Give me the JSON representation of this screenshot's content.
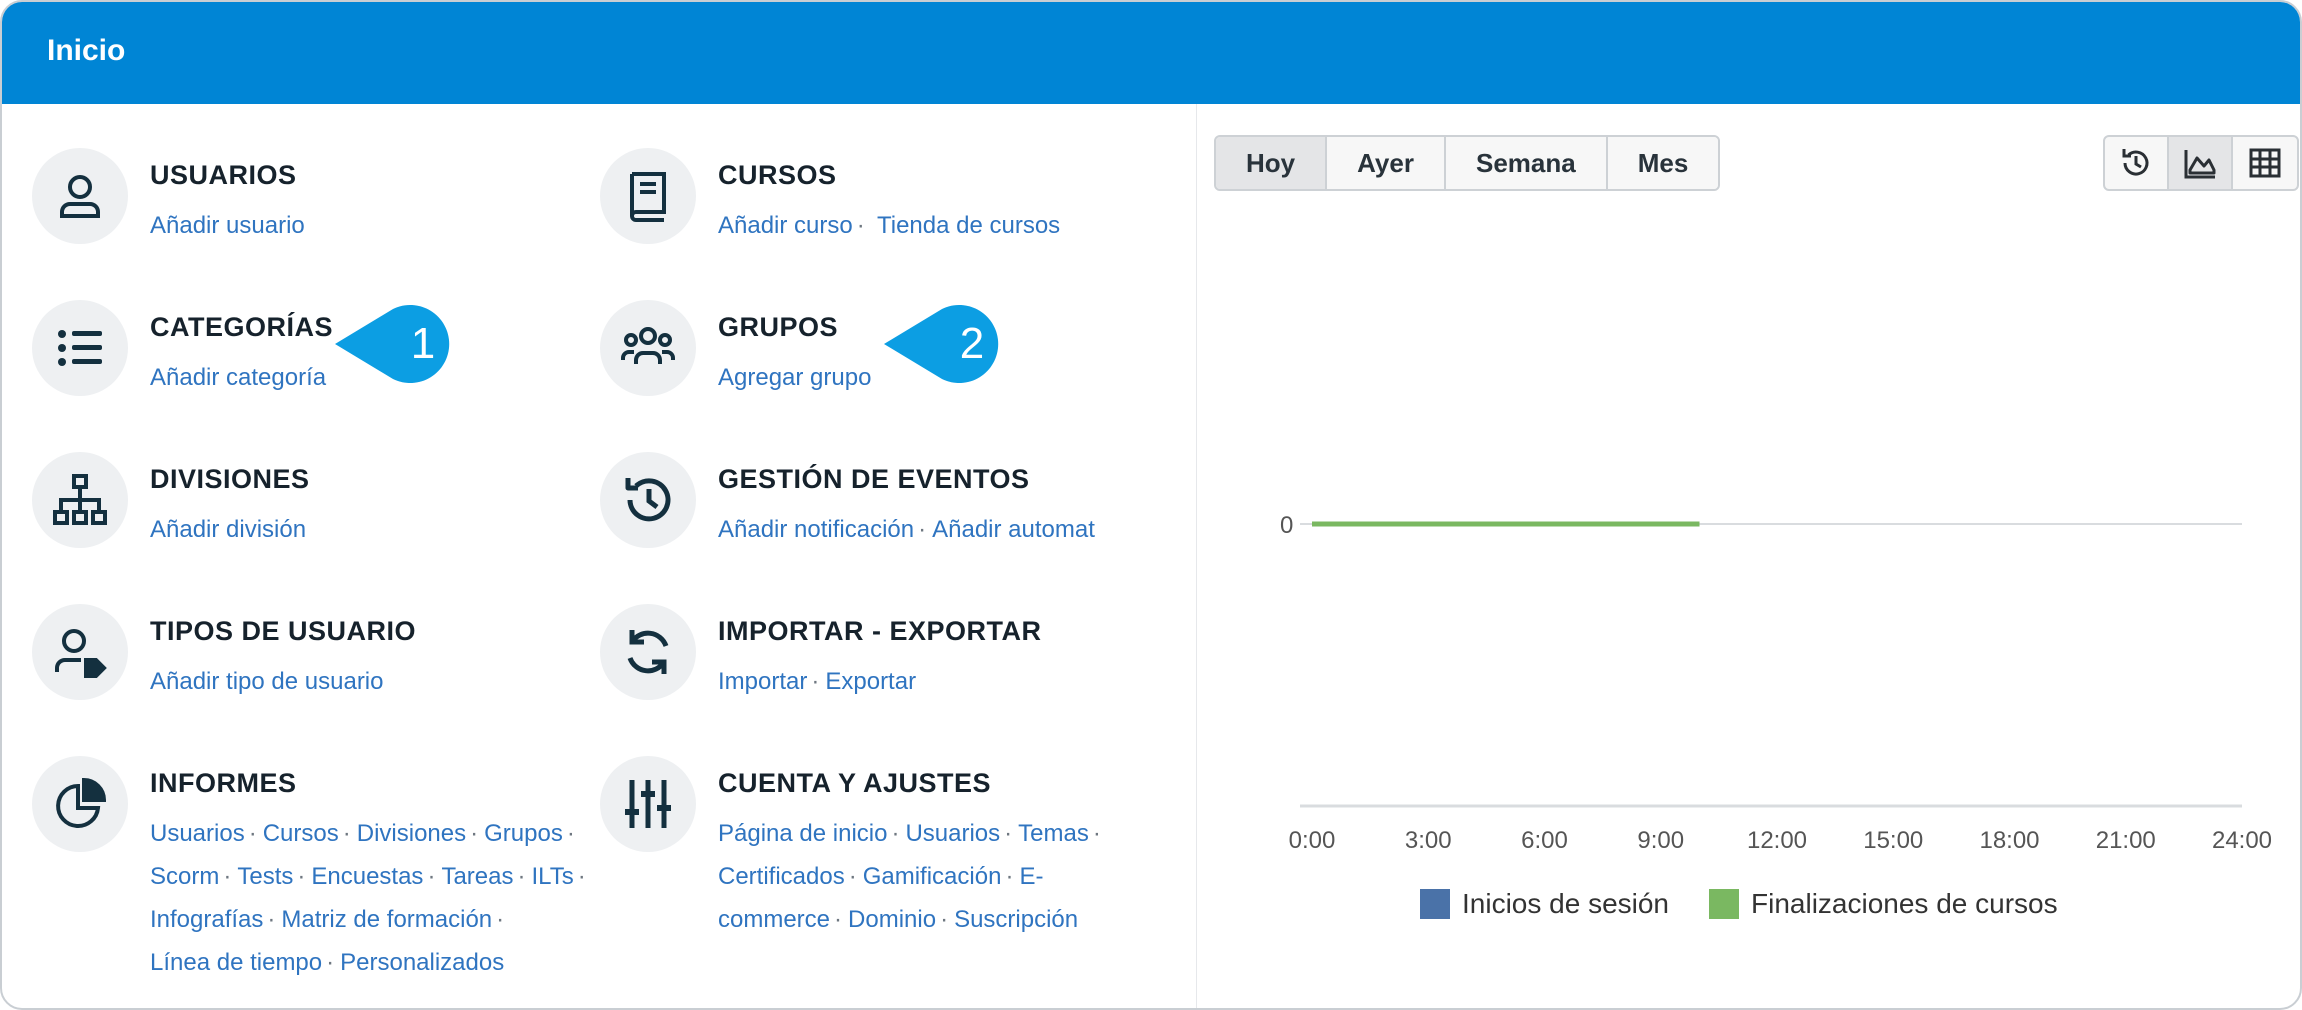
{
  "header": {
    "title": "Inicio"
  },
  "tiles": {
    "usuarios": {
      "title": "USUARIOS",
      "links": [
        "Añadir usuario"
      ]
    },
    "cursos": {
      "title": "CURSOS",
      "links": [
        "Añadir curso",
        "Tienda de cursos"
      ]
    },
    "categorias": {
      "title": "CATEGORÍAS",
      "links": [
        "Añadir categoría"
      ]
    },
    "grupos": {
      "title": "GRUPOS",
      "links": [
        "Agregar grupo"
      ]
    },
    "divisiones": {
      "title": "DIVISIONES",
      "links": [
        "Añadir división"
      ]
    },
    "eventos": {
      "title": "GESTIÓN DE EVENTOS",
      "links": [
        "Añadir notificación",
        "Añadir automat"
      ]
    },
    "tipos": {
      "title": "TIPOS DE USUARIO",
      "links": [
        "Añadir tipo de usuario"
      ]
    },
    "importar": {
      "title": "IMPORTAR - EXPORTAR",
      "links": [
        "Importar",
        "Exportar"
      ]
    },
    "informes": {
      "title": "INFORMES",
      "links": [
        "Usuarios",
        "Cursos",
        "Divisiones",
        "Grupos",
        "Scorm",
        "Tests",
        "Encuestas",
        "Tareas",
        "ILTs",
        "Infografías",
        "Matriz de formación",
        "Línea de tiempo",
        "Personalizados"
      ]
    },
    "cuenta": {
      "title": "CUENTA Y AJUSTES",
      "links": [
        "Página de inicio",
        "Usuarios",
        "Temas",
        "Certificados",
        "Gamificación",
        "E-commerce",
        "Dominio",
        "Suscripción"
      ]
    }
  },
  "callouts": {
    "one": "1",
    "two": "2"
  },
  "period_tabs": [
    "Hoy",
    "Ayer",
    "Semana",
    "Mes"
  ],
  "period_selected": "Hoy",
  "view_icons": [
    "history-icon",
    "area-chart-icon",
    "table-grid-icon"
  ],
  "view_selected": "area-chart-icon",
  "colors": {
    "header": "#0085d5",
    "link": "#2f74c0",
    "callout": "#0c9ee3",
    "series_logins": "#4a72a8",
    "series_completions": "#7ab861"
  },
  "chart_data": {
    "type": "line",
    "x": [
      "0:00",
      "3:00",
      "6:00",
      "9:00",
      "12:00",
      "15:00",
      "18:00",
      "21:00",
      "24:00"
    ],
    "ytick_labels": [
      "0"
    ],
    "series": [
      {
        "name": "Inicios de sesión",
        "color": "#4a72a8",
        "points": [
          [
            0,
            0
          ],
          [
            10,
            0
          ]
        ]
      },
      {
        "name": "Finalizaciones de cursos",
        "color": "#7ab861",
        "points": [
          [
            0,
            0
          ],
          [
            10,
            0
          ]
        ]
      }
    ],
    "xlim": [
      0,
      24
    ],
    "legend": "bottom"
  }
}
